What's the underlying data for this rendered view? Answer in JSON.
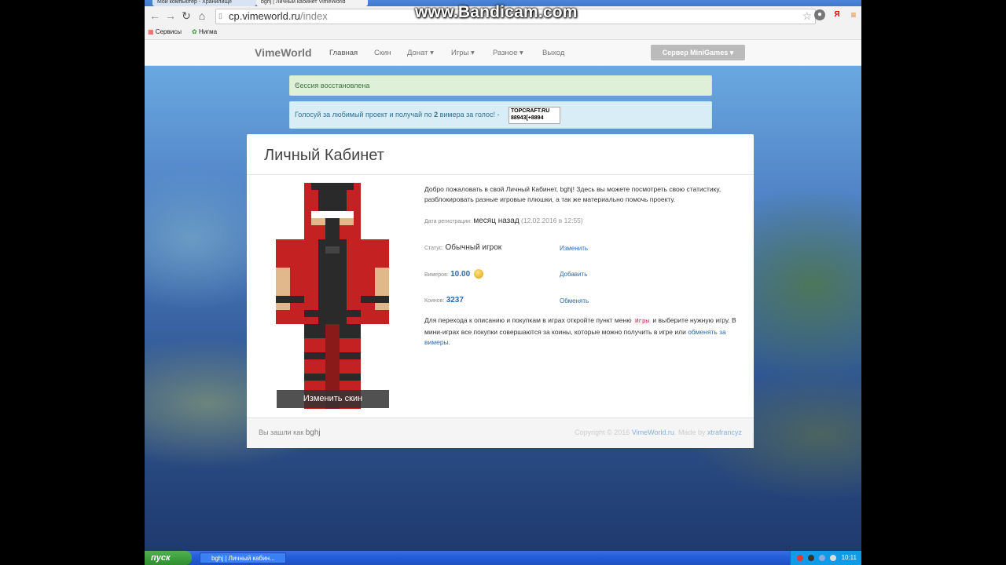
{
  "browser": {
    "tabs": [
      {
        "label": "Мой компьютер - Хранилище"
      },
      {
        "label": "bghj | Личный кабинет VimeWorld"
      }
    ],
    "url_main": "cp.vimeworld.ru",
    "url_path": "/index",
    "bookmarks": [
      {
        "label": "Сервисы"
      },
      {
        "label": "Нигма"
      }
    ],
    "ext_yandex": "Я"
  },
  "watermark": "www.Bandicam.com",
  "navbar": {
    "brand": "VimeWorld",
    "links": [
      "Главная",
      "Скин",
      "Донат ▾",
      "Игры ▾",
      "Разное ▾",
      "Выход"
    ],
    "server_button": "Сервер MiniGames ▾"
  },
  "alerts": {
    "session": "Сессия восстановлена",
    "vote_prefix": "Голосуй за любимый проект и получай по",
    "vote_count": "2",
    "vote_suffix": "вимера за голос! -",
    "topcraft_line1": "TOPCRAFT.RU",
    "topcraft_line2": "88943[+8894"
  },
  "panel": {
    "title": "Личный Кабинет",
    "welcome": "Добро пожаловать в свой Личный Кабинет, bghj! Здесь вы можете посмотреть свою статистику, разблокировать разные игровые плюшки, а так же материально помочь проекту.",
    "reg_label": "Дата регистрации:",
    "reg_value": "месяц назад",
    "reg_date": "(12.02.2016 в 12:55)",
    "status_label": "Статус:",
    "status_value": "Обычный игрок",
    "status_action": "Изменить",
    "vimers_label": "Вимеров:",
    "vimers_value": "10.00",
    "vimers_action": "Добавить",
    "coins_label": "Коинов:",
    "coins_value": "3237",
    "coins_action": "Обменять",
    "games_text_1": "Для перехода к описанию и покупкам в играх откройте пункт меню",
    "games_tag": "Игры",
    "games_text_2": "и выберите нужную игру. В мини-играх все покупки совершаются за коины, которые можно получить в игре или",
    "games_link": "обменять за вимеры",
    "games_end": ".",
    "skin_button": "Изменить скин",
    "footer_left": "Вы зашли как",
    "footer_user": "bghj",
    "footer_copy": "Copyright © 2016",
    "footer_site": "VimeWorld.ru",
    "footer_made": ". Made by",
    "footer_author": "xtrafrancyz"
  },
  "taskbar": {
    "start": "пуск",
    "task": "bghj | Личный кабин...",
    "lang": "EN",
    "clock": "10:11"
  },
  "colors": {
    "accent": "#2a6ab0",
    "success_bg": "#dff0d8",
    "info_bg": "#d9edf7",
    "skin_red": "#cc2a2a",
    "skin_black": "#2a2a2a"
  }
}
